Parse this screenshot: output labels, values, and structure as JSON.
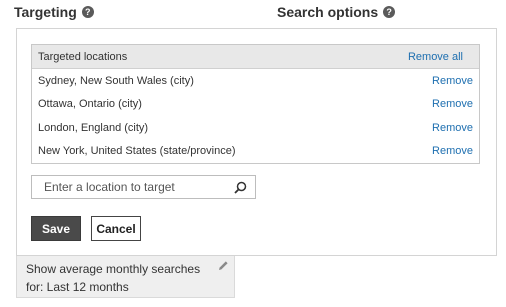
{
  "targeting": {
    "title": "Targeting",
    "help_icon": "help-icon"
  },
  "search_options": {
    "title": "Search options",
    "help_icon": "help-icon"
  },
  "locations": {
    "header_label": "Targeted locations",
    "remove_all_label": "Remove all",
    "rows": [
      {
        "name": "Sydney, New South Wales (city)",
        "action": "Remove"
      },
      {
        "name": "Ottawa, Ontario (city)",
        "action": "Remove"
      },
      {
        "name": "London, England (city)",
        "action": "Remove"
      },
      {
        "name": "New York, United States (state/province)",
        "action": "Remove"
      }
    ]
  },
  "search": {
    "placeholder": "Enter a location to target",
    "icon": "search-icon"
  },
  "actions": {
    "save_label": "Save",
    "cancel_label": "Cancel"
  },
  "monthly_searches": {
    "text": "Show average monthly searches for: Last 12 months",
    "icon": "pencil-icon"
  },
  "colors": {
    "link": "#1e6fb0",
    "save_bg": "#4a4a4a",
    "header_bg": "#e8e8e8"
  }
}
